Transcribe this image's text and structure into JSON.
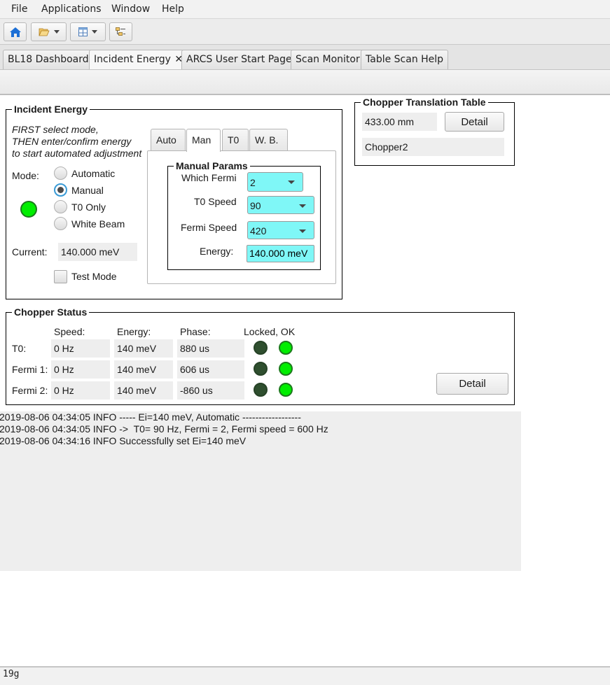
{
  "menubar": {
    "items": [
      "File",
      "Applications",
      "Window",
      "Help"
    ]
  },
  "toolbar": {
    "buttons": [
      {
        "icon": "home-icon"
      },
      {
        "icon": "folder-open-icon",
        "has_dropdown": true
      },
      {
        "icon": "layout-icon",
        "has_dropdown": true
      },
      {
        "icon": "tree-icon"
      }
    ]
  },
  "tabs": [
    {
      "label": "BL18 Dashboard",
      "active": false
    },
    {
      "label": "Incident Energy",
      "active": true,
      "closable": true,
      "close_glyph": "✕"
    },
    {
      "label": "ARCS User Start Page",
      "active": false
    },
    {
      "label": "Scan Monitor",
      "active": false
    },
    {
      "label": "Table Scan Help",
      "active": false
    }
  ],
  "incident_energy": {
    "title": "Incident Energy",
    "instructions": [
      "FIRST select mode,",
      "THEN enter/confirm energy",
      "to start automated adjustment"
    ],
    "mode_label": "Mode:",
    "modes": [
      {
        "label": "Automatic",
        "checked": false
      },
      {
        "label": "Manual",
        "checked": true
      },
      {
        "label": "T0 Only",
        "checked": false
      },
      {
        "label": "White Beam",
        "checked": false
      }
    ],
    "status_color": "#00ee00",
    "current_label": "Current:",
    "current_value": "140.000 meV",
    "test_mode_label": "Test Mode",
    "test_mode_checked": false,
    "param_tabs": [
      {
        "label": "Auto",
        "active": false
      },
      {
        "label": "Man",
        "active": true
      },
      {
        "label": "T0",
        "active": false
      },
      {
        "label": "W. B.",
        "active": false
      }
    ],
    "manual_params": {
      "title": "Manual Params",
      "which_fermi_label": "Which Fermi",
      "which_fermi_value": "2",
      "t0_speed_label": "T0 Speed",
      "t0_speed_value": "90",
      "fermi_speed_label": "Fermi Speed",
      "fermi_speed_value": "420",
      "energy_label": "Energy:",
      "energy_value": "140.000 meV",
      "input_color": "#7ff7f7"
    }
  },
  "chopper_translation": {
    "title": "Chopper Translation Table",
    "position": "433.00 mm",
    "detail_label": "Detail",
    "chopper_name": "Chopper2"
  },
  "chopper_status": {
    "title": "Chopper Status",
    "headers": {
      "speed": "Speed:",
      "energy": "Energy:",
      "phase": "Phase:",
      "locked_ok": "Locked, OK"
    },
    "rows": [
      {
        "name": "T0:",
        "speed": "0 Hz",
        "energy": "140 meV",
        "phase": "880 us",
        "locked": false,
        "ok": true
      },
      {
        "name": "Fermi 1:",
        "speed": "0 Hz",
        "energy": "140 meV",
        "phase": "606 us",
        "locked": false,
        "ok": true
      },
      {
        "name": "Fermi 2:",
        "speed": "0 Hz",
        "energy": "140 meV",
        "phase": "-860 us",
        "locked": false,
        "ok": true
      }
    ],
    "detail_label": "Detail"
  },
  "log": {
    "lines": [
      "2019-08-06 04:34:05 INFO ----- Ei=140 meV, Automatic ------------------",
      "2019-08-06 04:34:05 INFO ->  T0= 90 Hz, Fermi = 2, Fermi speed = 600 Hz",
      "2019-08-06 04:34:16 INFO Successfully set Ei=140 meV"
    ]
  },
  "statusbar": {
    "text": "19g"
  }
}
